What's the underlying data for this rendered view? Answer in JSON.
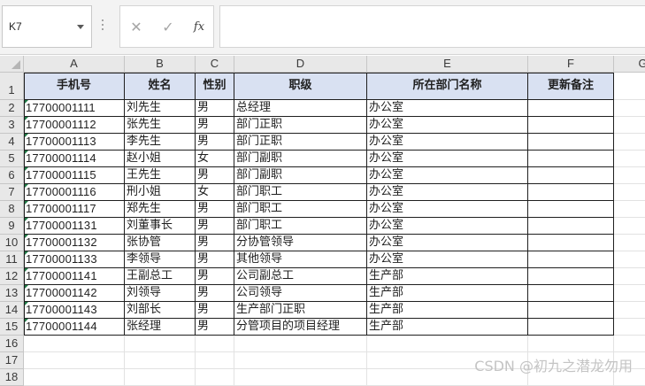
{
  "name_box": {
    "value": "K7"
  },
  "formula_bar": {
    "cancel_icon": "✕",
    "enter_icon": "✓",
    "function_label": "fx",
    "content": ""
  },
  "columns": [
    "A",
    "B",
    "C",
    "D",
    "E",
    "F",
    "G"
  ],
  "rows": [
    "1",
    "2",
    "3",
    "4",
    "5",
    "6",
    "7",
    "8",
    "9",
    "10",
    "11",
    "12",
    "13",
    "14",
    "15",
    "16",
    "17",
    "18"
  ],
  "table": {
    "headers": [
      "手机号",
      "姓名",
      "性别",
      "职级",
      "所在部门名称",
      "更新备注"
    ],
    "data": [
      [
        "17700001111",
        "刘先生",
        "男",
        "总经理",
        "办公室",
        ""
      ],
      [
        "17700001112",
        "张先生",
        "男",
        "部门正职",
        "办公室",
        ""
      ],
      [
        "17700001113",
        "李先生",
        "男",
        "部门正职",
        "办公室",
        ""
      ],
      [
        "17700001114",
        "赵小姐",
        "女",
        "部门副职",
        "办公室",
        ""
      ],
      [
        "17700001115",
        "王先生",
        "男",
        "部门副职",
        "办公室",
        ""
      ],
      [
        "17700001116",
        "刑小姐",
        "女",
        "部门职工",
        "办公室",
        ""
      ],
      [
        "17700001117",
        "郑先生",
        "男",
        "部门职工",
        "办公室",
        ""
      ],
      [
        "17700001131",
        "刘董事长",
        "男",
        "部门职工",
        "办公室",
        ""
      ],
      [
        "17700001132",
        "张协管",
        "男",
        "分协管领导",
        "办公室",
        ""
      ],
      [
        "17700001133",
        "李领导",
        "男",
        "其他领导",
        "办公室",
        ""
      ],
      [
        "17700001141",
        "王副总工",
        "男",
        "公司副总工",
        "生产部",
        ""
      ],
      [
        "17700001142",
        "刘领导",
        "男",
        "公司领导",
        "生产部",
        ""
      ],
      [
        "17700001143",
        "刘部长",
        "男",
        "生产部门正职",
        "生产部",
        ""
      ],
      [
        "17700001144",
        "张经理",
        "男",
        "分管项目的项目经理",
        "生产部",
        ""
      ]
    ]
  },
  "watermark": "CSDN @初九之潜龙勿用"
}
